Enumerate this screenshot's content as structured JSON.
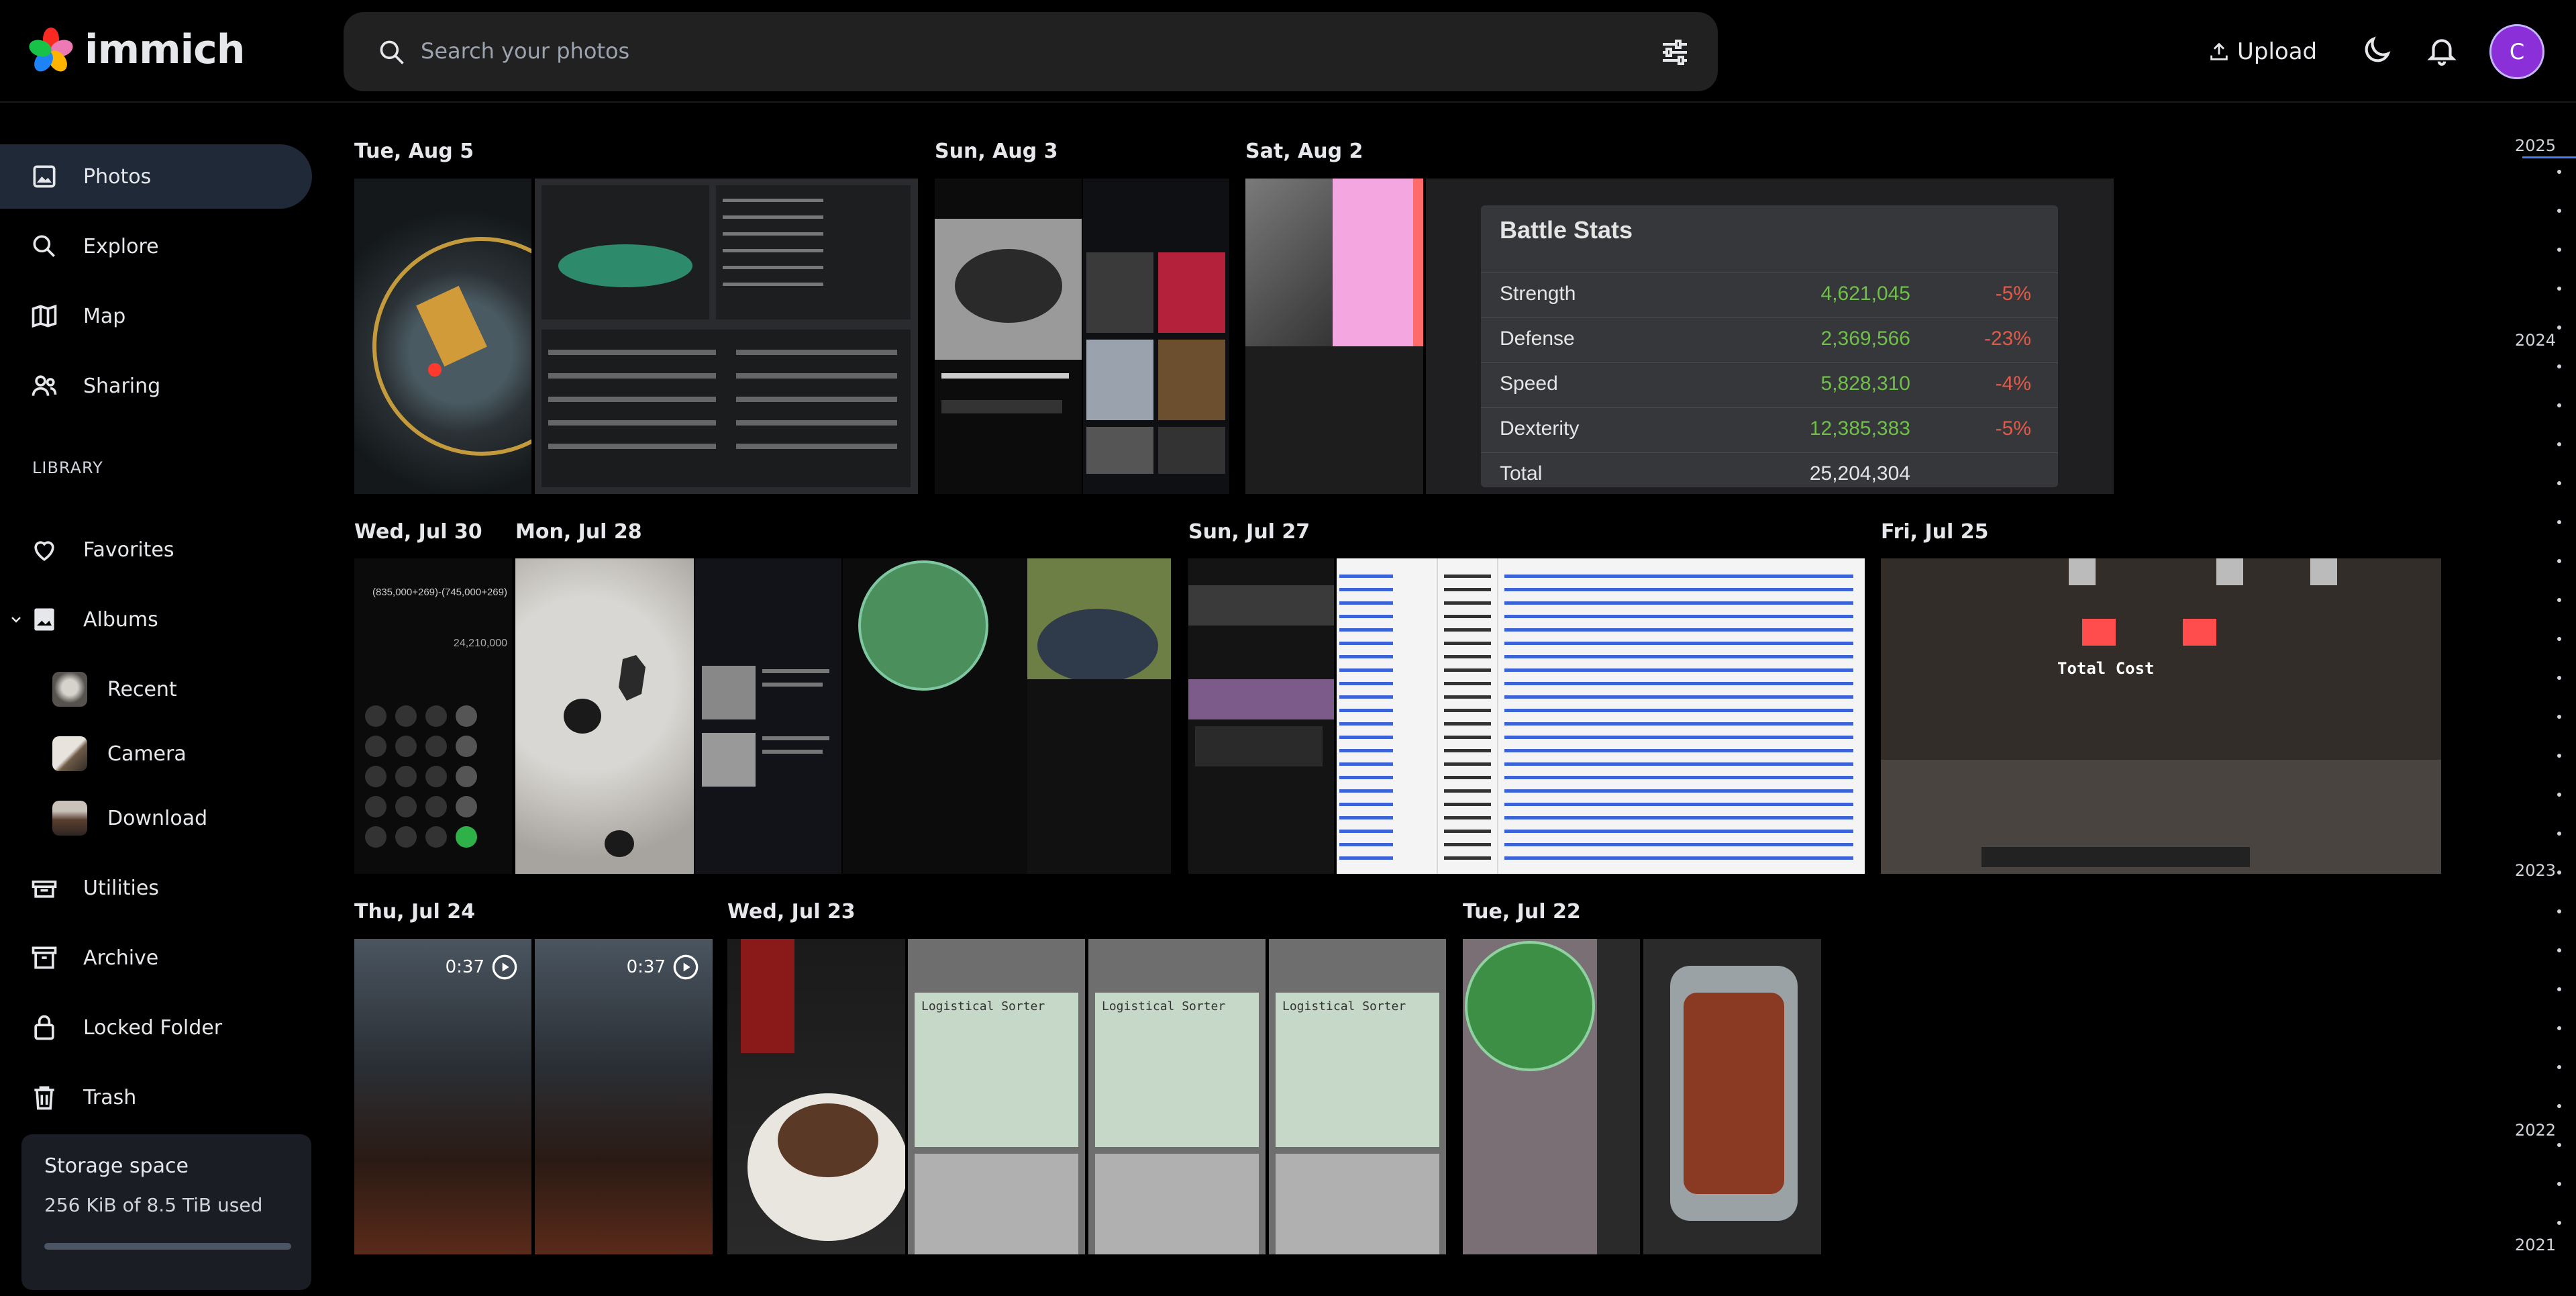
{
  "app": {
    "name": "immich"
  },
  "search": {
    "placeholder": "Search your photos"
  },
  "header": {
    "upload_label": "Upload",
    "avatar_initial": "C"
  },
  "sidebar": {
    "items": [
      {
        "label": "Photos",
        "icon": "photos-icon",
        "active": true
      },
      {
        "label": "Explore",
        "icon": "search-icon"
      },
      {
        "label": "Map",
        "icon": "map-icon"
      },
      {
        "label": "Sharing",
        "icon": "sharing-icon"
      }
    ],
    "library_heading": "LIBRARY",
    "library": [
      {
        "label": "Favorites",
        "icon": "heart-icon"
      },
      {
        "label": "Albums",
        "icon": "albums-icon"
      }
    ],
    "albums": [
      {
        "label": "Recent"
      },
      {
        "label": "Camera"
      },
      {
        "label": "Download"
      }
    ],
    "more": [
      {
        "label": "Utilities",
        "icon": "utilities-icon"
      },
      {
        "label": "Archive",
        "icon": "archive-icon"
      },
      {
        "label": "Locked Folder",
        "icon": "lock-icon"
      },
      {
        "label": "Trash",
        "icon": "trash-icon"
      }
    ],
    "storage": {
      "title": "Storage space",
      "used": "256 KiB of 8.5 TiB used",
      "fraction": 0.0
    }
  },
  "timeline": {
    "groups": [
      {
        "date": "Tue, Aug 5"
      },
      {
        "date": "Sun, Aug 3"
      },
      {
        "date": "Sat, Aug 2"
      },
      {
        "date": "Wed, Jul 30"
      },
      {
        "date": "Mon, Jul 28"
      },
      {
        "date": "Sun, Jul 27"
      },
      {
        "date": "Fri, Jul 25"
      },
      {
        "date": "Thu, Jul 24"
      },
      {
        "date": "Wed, Jul 23"
      },
      {
        "date": "Tue, Jul 22"
      }
    ],
    "video_durations": [
      "0:37",
      "0:37"
    ],
    "battle_stats": {
      "title": "Battle Stats",
      "rows": [
        {
          "name": "Strength",
          "value": "4,621,045",
          "change": "-5%"
        },
        {
          "name": "Defense",
          "value": "2,369,566",
          "change": "-23%"
        },
        {
          "name": "Speed",
          "value": "5,828,310",
          "change": "-4%"
        },
        {
          "name": "Dexterity",
          "value": "12,385,383",
          "change": "-5%"
        },
        {
          "name": "Total",
          "value": "25,204,304",
          "change": ""
        }
      ]
    },
    "calc_screen": {
      "expr": "(835,000+269)-(745,000+269)",
      "result": "24,210,000"
    },
    "mc_overlay": {
      "label": "Total Cost"
    },
    "sorter_title": "Logistical Sorter"
  },
  "scrubber": {
    "years": [
      "2025",
      "2024",
      "2023",
      "2022",
      "2021"
    ]
  }
}
